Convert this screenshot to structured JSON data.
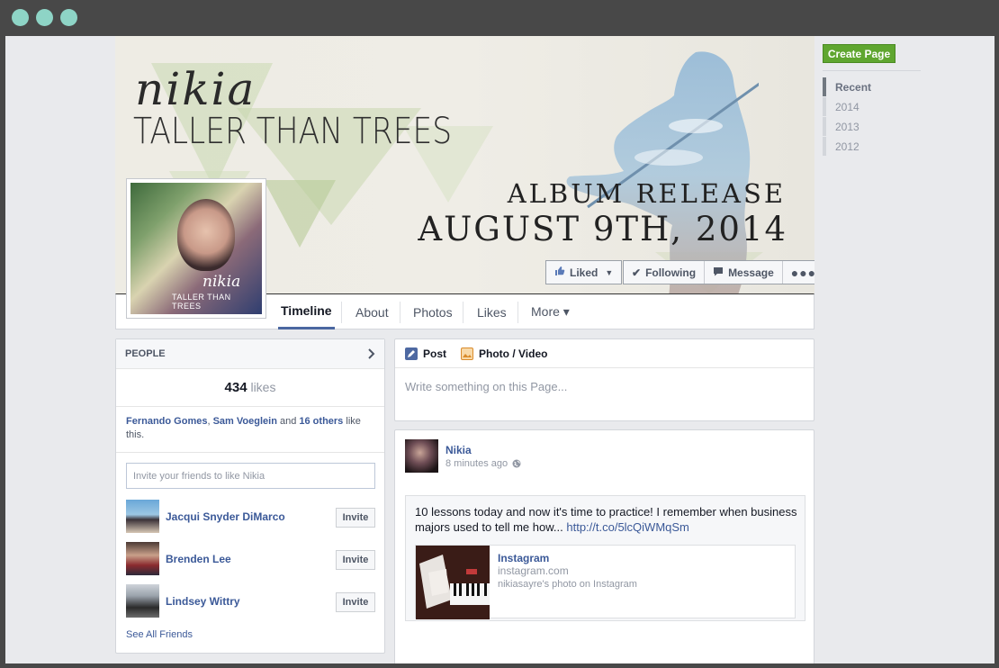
{
  "colors": {
    "window_chrome": "#484848",
    "window_dot": "#8ed4c6",
    "fb_link": "#3b5998",
    "create_page_green": "#5fa630"
  },
  "cover": {
    "artist_script": "nikia",
    "album_title": "TALLER THAN TREES",
    "release_label": "ALBUM RELEASE",
    "release_date": "AUGUST 9TH, 2014",
    "liked_label": "Liked",
    "following_label": "Following",
    "message_label": "Message",
    "more_icon": "ellipsis-icon"
  },
  "profile_picture": {
    "script": "nikia",
    "album": "TALLER THAN TREES"
  },
  "nav": {
    "tabs": [
      {
        "label": "Timeline"
      },
      {
        "label": "About"
      },
      {
        "label": "Photos"
      },
      {
        "label": "Likes"
      },
      {
        "label": "More ▾"
      }
    ]
  },
  "rail": {
    "create_page": "Create Page",
    "years": [
      "Recent",
      "2014",
      "2013",
      "2012"
    ]
  },
  "people": {
    "header": "PEOPLE",
    "likes_count": "434",
    "likes_word": "likes",
    "liker_1": "Fernando Gomes",
    "liker_sep": ", ",
    "liker_2": "Sam Voeglein",
    "and_text": " and ",
    "others": "16 others",
    "like_this": " like this.",
    "invite_placeholder": "Invite your friends to like Nikia",
    "friends": [
      {
        "name": "Jacqui Snyder DiMarco",
        "button": "Invite"
      },
      {
        "name": "Brenden Lee",
        "button": "Invite"
      },
      {
        "name": "Lindsey Wittry",
        "button": "Invite"
      }
    ],
    "see_all": "See All Friends"
  },
  "composer": {
    "post_tab": "Post",
    "photo_tab": "Photo / Video",
    "placeholder": "Write something on this Page..."
  },
  "post": {
    "author": "Nikia",
    "time": "8 minutes ago",
    "text": "10 lessons today and now it's time to practice! I remember when business majors used to tell me how... ",
    "link": "http://t.co/5lcQiWMqSm",
    "attachment": {
      "title": "Instagram",
      "domain": "instagram.com",
      "description": "nikiasayre's photo on Instagram"
    }
  }
}
